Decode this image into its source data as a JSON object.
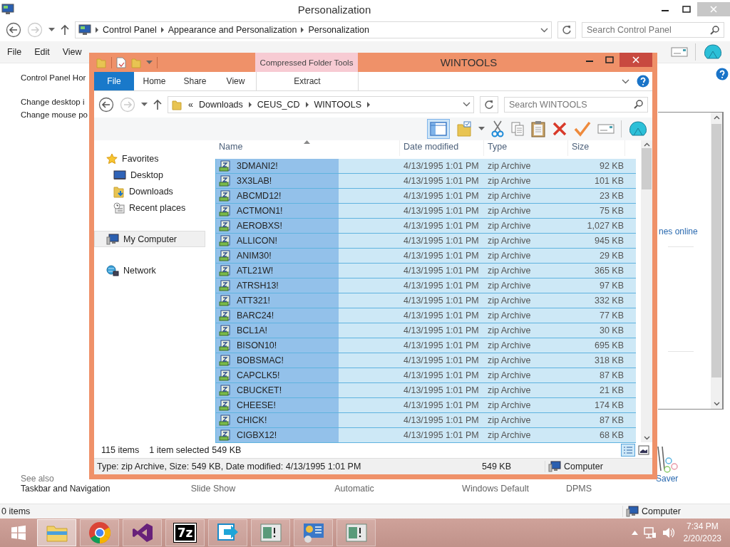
{
  "control_panel": {
    "title": "Personalization",
    "address": [
      "Control Panel",
      "Appearance and Personalization",
      "Personalization"
    ],
    "search": {
      "placeholder": "Search Control Panel"
    },
    "menu": [
      "File",
      "Edit",
      "View"
    ],
    "home_link": "Control Panel Hor",
    "side_links": [
      "Change desktop i",
      "Change mouse po"
    ],
    "link_fragment": "nes online",
    "see_also": {
      "heading": "See also",
      "links": [
        "Taskbar and Navigation"
      ]
    },
    "screen_saver_label": "Saver",
    "settings": [
      "Slide Show",
      "Automatic",
      "Windows Default",
      "DPMS"
    ],
    "status_bar": {
      "items": "0 items",
      "location": "Computer"
    }
  },
  "explorer": {
    "title": "WINTOOLS",
    "contextual_group": "Compressed Folder Tools",
    "ribbon_tabs": [
      {
        "label": "File",
        "kind": "file",
        "selected": false
      },
      {
        "label": "Home",
        "kind": "tab",
        "selected": false
      },
      {
        "label": "Share",
        "kind": "tab",
        "selected": false
      },
      {
        "label": "View",
        "kind": "tab",
        "selected": false
      },
      {
        "label": "Extract",
        "kind": "contextual",
        "selected": false
      }
    ],
    "address": {
      "overflow": "«",
      "crumbs": [
        "Downloads",
        "CEUS_CD",
        "WINTOOLS"
      ]
    },
    "search": {
      "placeholder": "Search WINTOOLS"
    },
    "navigation": [
      {
        "label": "Favorites",
        "kind": "star",
        "selected": false,
        "children": [
          {
            "label": "Desktop",
            "kind": "desktop",
            "selected": false
          },
          {
            "label": "Downloads",
            "kind": "downloads",
            "selected": false
          },
          {
            "label": "Recent places",
            "kind": "recent",
            "selected": false
          }
        ]
      },
      {
        "label": "My Computer",
        "kind": "computer",
        "selected": true
      },
      {
        "label": "Network",
        "kind": "network",
        "selected": false
      }
    ],
    "table": {
      "columns": [
        "Name",
        "Date modified",
        "Type",
        "Size"
      ],
      "rows": [
        {
          "name": "3DMANI2!",
          "date": "4/13/1995 1:01 PM",
          "type": "zip Archive",
          "size": "92 KB",
          "selected": true
        },
        {
          "name": "3X3LAB!",
          "date": "4/13/1995 1:01 PM",
          "type": "zip Archive",
          "size": "101 KB",
          "selected": true
        },
        {
          "name": "ABCMD12!",
          "date": "4/13/1995 1:01 PM",
          "type": "zip Archive",
          "size": "23 KB",
          "selected": true
        },
        {
          "name": "ACTMON1!",
          "date": "4/13/1995 1:01 PM",
          "type": "zip Archive",
          "size": "75 KB",
          "selected": true
        },
        {
          "name": "AEROBXS!",
          "date": "4/13/1995 1:01 PM",
          "type": "zip Archive",
          "size": "1,027 KB",
          "selected": true
        },
        {
          "name": "ALLICON!",
          "date": "4/13/1995 1:01 PM",
          "type": "zip Archive",
          "size": "945 KB",
          "selected": true
        },
        {
          "name": "ANIM30!",
          "date": "4/13/1995 1:01 PM",
          "type": "zip Archive",
          "size": "29 KB",
          "selected": true
        },
        {
          "name": "ATL21W!",
          "date": "4/13/1995 1:01 PM",
          "type": "zip Archive",
          "size": "365 KB",
          "selected": true
        },
        {
          "name": "ATRSH13!",
          "date": "4/13/1995 1:01 PM",
          "type": "zip Archive",
          "size": "97 KB",
          "selected": true
        },
        {
          "name": "ATT321!",
          "date": "4/13/1995 1:01 PM",
          "type": "zip Archive",
          "size": "332 KB",
          "selected": true
        },
        {
          "name": "BARC24!",
          "date": "4/13/1995 1:01 PM",
          "type": "zip Archive",
          "size": "77 KB",
          "selected": true
        },
        {
          "name": "BCL1A!",
          "date": "4/13/1995 1:01 PM",
          "type": "zip Archive",
          "size": "30 KB",
          "selected": true
        },
        {
          "name": "BISON10!",
          "date": "4/13/1995 1:01 PM",
          "type": "zip Archive",
          "size": "695 KB",
          "selected": true
        },
        {
          "name": "BOBSMAC!",
          "date": "4/13/1995 1:01 PM",
          "type": "zip Archive",
          "size": "318 KB",
          "selected": true
        },
        {
          "name": "CAPCLK5!",
          "date": "4/13/1995 1:01 PM",
          "type": "zip Archive",
          "size": "87 KB",
          "selected": true
        },
        {
          "name": "CBUCKET!",
          "date": "4/13/1995 1:01 PM",
          "type": "zip Archive",
          "size": "21 KB",
          "selected": true
        },
        {
          "name": "CHEESE!",
          "date": "4/13/1995 1:01 PM",
          "type": "zip Archive",
          "size": "174 KB",
          "selected": true
        },
        {
          "name": "CHICK!",
          "date": "4/13/1995 1:01 PM",
          "type": "zip Archive",
          "size": "87 KB",
          "selected": true
        },
        {
          "name": "CIGBX12!",
          "date": "4/13/1995 1:01 PM",
          "type": "zip Archive",
          "size": "68 KB",
          "selected": true
        }
      ]
    },
    "status_bar": {
      "count": "115 items",
      "selection": "1 item selected",
      "selection_size": "549 KB"
    },
    "details_bar": {
      "info": "Type: zip Archive, Size: 549 KB, Date modified: 4/13/1995 1:01 PM",
      "size": "549 KB",
      "location": "Computer"
    }
  },
  "taskbar": {
    "apps": [
      {
        "kind": "explorer",
        "active": true
      },
      {
        "kind": "chrome",
        "active": false
      },
      {
        "kind": "studio",
        "active": false
      },
      {
        "kind": "zip",
        "label": "7z",
        "active": false
      },
      {
        "kind": "remote",
        "active": false
      },
      {
        "kind": "card",
        "active": false
      },
      {
        "kind": "panel",
        "active": false
      },
      {
        "kind": "card",
        "active": false
      }
    ],
    "clock": {
      "time": "7:34 PM",
      "date": "2/20/2023"
    }
  }
}
